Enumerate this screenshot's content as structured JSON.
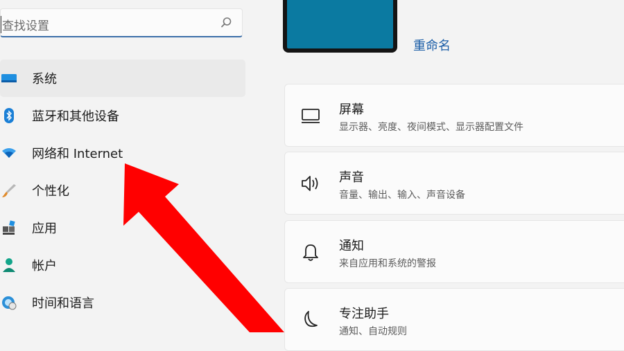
{
  "search": {
    "placeholder": "查找设置",
    "icon": "search-icon"
  },
  "sidebar": {
    "items": [
      {
        "label": "系统",
        "icon": "monitor-icon",
        "active": true
      },
      {
        "label": "蓝牙和其他设备",
        "icon": "bluetooth-icon"
      },
      {
        "label": "网络和 Internet",
        "icon": "wifi-icon"
      },
      {
        "label": "个性化",
        "icon": "brush-icon"
      },
      {
        "label": "应用",
        "icon": "apps-icon"
      },
      {
        "label": "帐户",
        "icon": "person-icon"
      },
      {
        "label": "时间和语言",
        "icon": "globe-clock-icon"
      }
    ]
  },
  "device": {
    "rename_label": "重命名",
    "thumb_color": "#0b7aa1"
  },
  "cards": [
    {
      "title": "屏幕",
      "subtitle": "显示器、亮度、夜间模式、显示器配置文件",
      "icon": "display-icon"
    },
    {
      "title": "声音",
      "subtitle": "音量、输出、输入、声音设备",
      "icon": "speaker-icon"
    },
    {
      "title": "通知",
      "subtitle": "来自应用和系统的警报",
      "icon": "bell-icon"
    },
    {
      "title": "专注助手",
      "subtitle": "通知、自动规则",
      "icon": "moon-icon"
    }
  ],
  "colors": {
    "accent": "#0067c0",
    "arrow": "#ff0000",
    "link": "#1d5fa8"
  }
}
